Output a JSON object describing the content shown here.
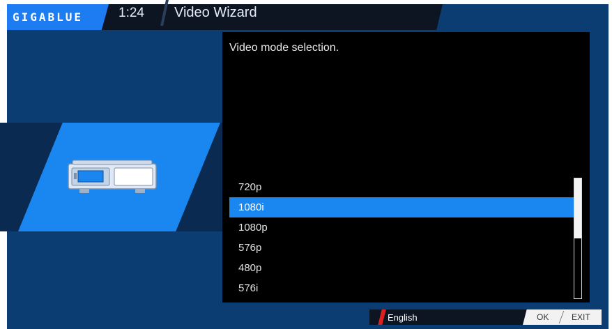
{
  "header": {
    "brand": "GIGABLUE",
    "time": "1:24",
    "title": "Video Wizard"
  },
  "panel": {
    "description": "Video mode selection.",
    "options": [
      "720p",
      "1080i",
      "1080p",
      "576p",
      "480p",
      "576i"
    ],
    "selected_index": 1,
    "scroll_fraction": 0.5
  },
  "footer": {
    "language": "English",
    "ok_label": "OK",
    "exit_label": "EXIT"
  },
  "colors": {
    "accent": "#1a86f0",
    "background": "#0b3d73",
    "language_marker": "#e02020"
  },
  "icons": {
    "device": "set-top-box-icon"
  }
}
